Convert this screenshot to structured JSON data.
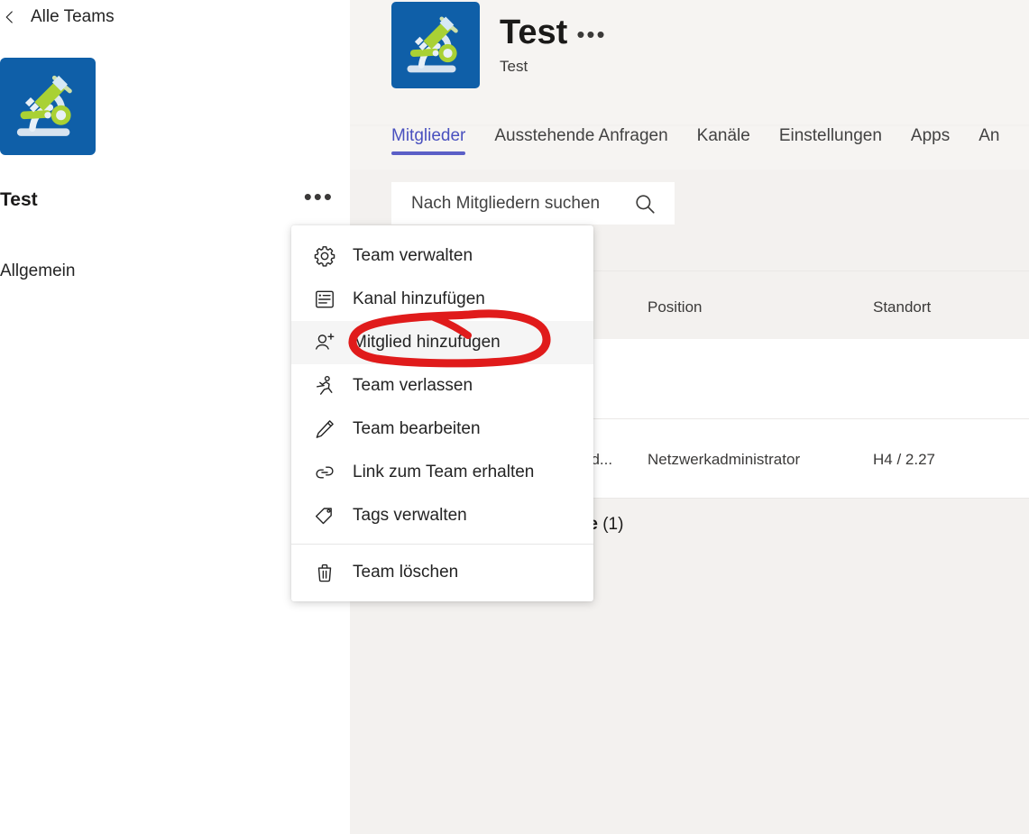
{
  "sidebar": {
    "back_label": "Alle Teams",
    "back_icon": "chevron-left-icon",
    "team_name": "Test",
    "more_label": "•••",
    "channel": "Allgemein",
    "avatar_icon": "microscope-icon"
  },
  "header": {
    "avatar_icon": "microscope-icon",
    "title": "Test",
    "more_label": "•••",
    "subtitle": "Test"
  },
  "tabs": [
    {
      "label": "Mitglieder",
      "active": true
    },
    {
      "label": "Ausstehende Anfragen",
      "active": false
    },
    {
      "label": "Kanäle",
      "active": false
    },
    {
      "label": "Einstellungen",
      "active": false
    },
    {
      "label": "Apps",
      "active": false
    },
    {
      "label": "An",
      "active": false
    }
  ],
  "search": {
    "placeholder": "Nach Mitgliedern suchen",
    "icon": "search-icon"
  },
  "table": {
    "columns": [
      "Position",
      "Standort"
    ],
    "col_position": "Position",
    "col_standort": "Standort",
    "rows": [
      {
        "name": "",
        "position": "",
        "standort": ""
      },
      {
        "name": "nd...",
        "position": "Netzwerkadministrator",
        "standort": "H4 / 2.27"
      }
    ]
  },
  "section": {
    "title_bold": "te",
    "title_count": "(1)"
  },
  "context_menu": {
    "items": [
      {
        "label": "Team verwalten",
        "icon": "gear-icon",
        "highlight": false
      },
      {
        "label": "Kanal hinzufügen",
        "icon": "channel-icon",
        "highlight": false
      },
      {
        "label": "Mitglied hinzufügen",
        "icon": "person-add-icon",
        "highlight": true
      },
      {
        "label": "Team verlassen",
        "icon": "run-person-icon",
        "highlight": false
      },
      {
        "label": "Team bearbeiten",
        "icon": "pencil-icon",
        "highlight": false
      },
      {
        "label": "Link zum Team erhalten",
        "icon": "link-icon",
        "highlight": false
      },
      {
        "label": "Tags verwalten",
        "icon": "tag-icon",
        "highlight": false
      }
    ],
    "delete_item": {
      "label": "Team löschen",
      "icon": "trash-icon"
    }
  },
  "annotation": {
    "name": "red-circle-highlight",
    "color": "#e01b1b",
    "targets": "Mitglied hinzufügen"
  },
  "colors": {
    "accent": "#5b5fc7",
    "avatar_bg": "#0f5fa8",
    "main_bg": "#f3f1ef",
    "row_bg": "#ffffff",
    "annotation_red": "#e01b1b"
  }
}
